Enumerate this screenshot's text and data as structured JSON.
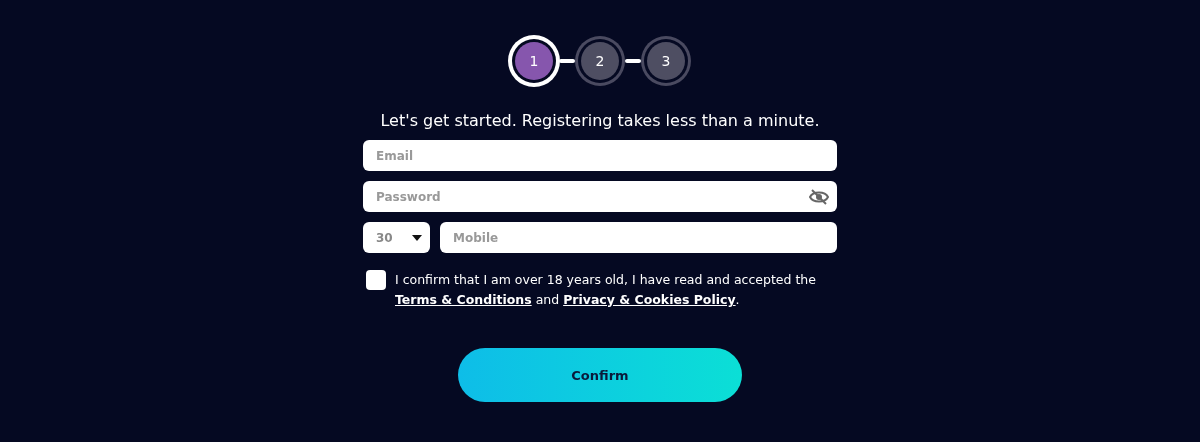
{
  "steps": [
    {
      "label": "1",
      "selected": true
    },
    {
      "label": "2",
      "selected": false
    },
    {
      "label": "3",
      "selected": false
    }
  ],
  "heading": "Let's get started. Registering takes less than a minute.",
  "email": {
    "placeholder": "Email"
  },
  "password": {
    "placeholder": "Password"
  },
  "country_code": {
    "value": "30"
  },
  "mobile": {
    "placeholder": "Mobile"
  },
  "consent": {
    "checked": false,
    "text_before": "I confirm that I am over 18 years old, I have read and accepted the",
    "terms_link": "Terms & Conditions",
    "text_middle": "and",
    "privacy_link": "Privacy & Cookies Policy",
    "text_after": "."
  },
  "confirm_button": "Confirm"
}
